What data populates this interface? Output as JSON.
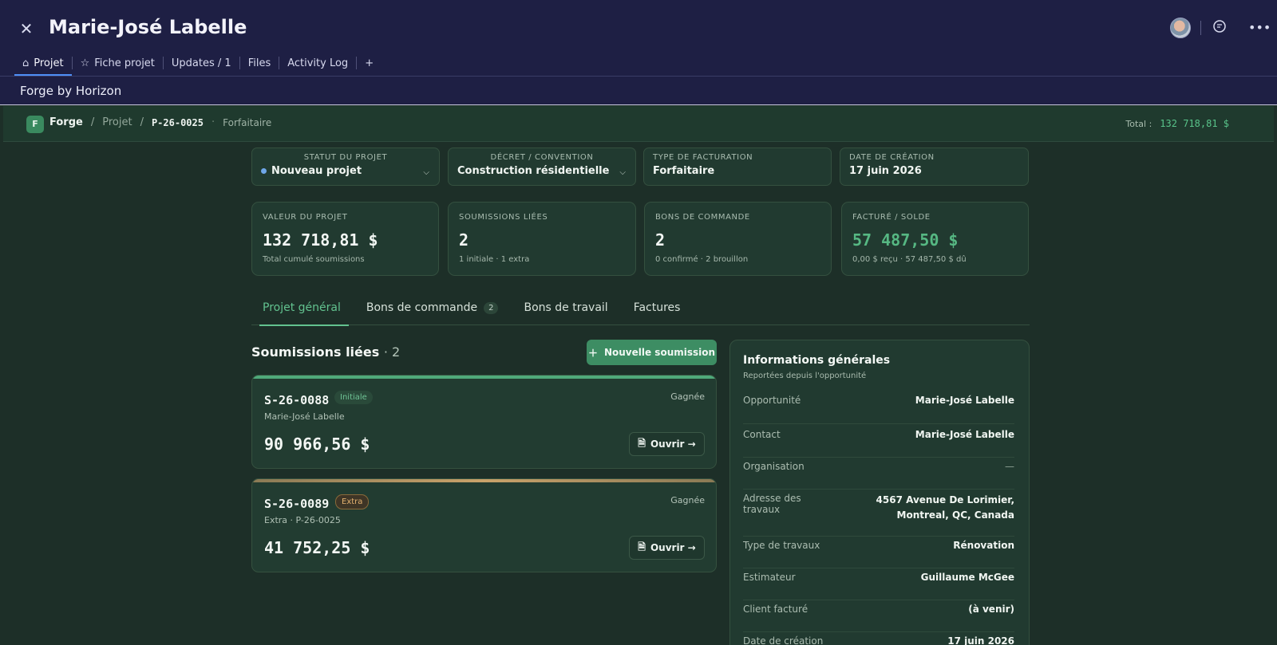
{
  "header": {
    "title": "Marie-José Labelle",
    "tabs": [
      {
        "label": "Projet",
        "icon": "home-icon"
      },
      {
        "label": "Fiche projet",
        "icon": "star-icon"
      },
      {
        "label": "Updates / 1"
      },
      {
        "label": "Files"
      },
      {
        "label": "Activity Log"
      },
      {
        "label": "+"
      }
    ]
  },
  "workspace": {
    "title": "Forge by Horizon"
  },
  "breadcrumb": {
    "logo_letter": "F",
    "app": "Forge",
    "section": "Projet",
    "project_code": "P-26-0025",
    "billing_type": "Forfaitaire",
    "total_label": "Total :",
    "total_value": "132 718,81 $"
  },
  "fields": {
    "status": {
      "label": "STATUT DU PROJET",
      "value": "Nouveau projet"
    },
    "decree": {
      "label": "DÉCRET / CONVENTION",
      "value": "Construction résidentielle"
    },
    "billing": {
      "label": "TYPE DE FACTURATION",
      "value": "Forfaitaire"
    },
    "created": {
      "label": "DATE DE CRÉATION",
      "value": "17 juin 2026"
    }
  },
  "stats": {
    "value": {
      "label": "VALEUR DU PROJET",
      "value": "132 718,81 $",
      "sub": "Total cumulé soumissions"
    },
    "submissions": {
      "label": "SOUMISSIONS LIÉES",
      "value": "2",
      "sub": "1 initiale · 1 extra"
    },
    "orders": {
      "label": "BONS DE COMMANDE",
      "value": "2",
      "sub": "0 confirmé · 2 brouillon"
    },
    "billed": {
      "label": "FACTURÉ / SOLDE",
      "value": "57 487,50 $",
      "sub": "0,00 $ reçu · 57 487,50 $ dû"
    }
  },
  "main_tabs": {
    "general": "Projet général",
    "orders": "Bons de commande",
    "orders_count": "2",
    "work": "Bons de travail",
    "invoices": "Factures"
  },
  "submissions": {
    "title": "Soumissions liées",
    "count": "· 2",
    "new_button": "Nouvelle soumission",
    "items": [
      {
        "code": "S-26-0088",
        "tag": "Initiale",
        "status": "Gagnée",
        "client": "Marie-José Labelle",
        "amount": "90 966,56 $",
        "open": "Ouvrir →"
      },
      {
        "code": "S-26-0089",
        "tag": "Extra",
        "status": "Gagnée",
        "client": "Extra · P-26-0025",
        "amount": "41 752,25 $",
        "open": "Ouvrir →"
      }
    ]
  },
  "info": {
    "title": "Informations générales",
    "subtitle": "Reportées depuis l'opportunité",
    "rows": [
      {
        "key": "Opportunité",
        "value": "Marie-José Labelle"
      },
      {
        "key": "Contact",
        "value": "Marie-José Labelle"
      },
      {
        "key": "Organisation",
        "value": "—"
      },
      {
        "key": "Adresse des travaux",
        "value": "4567 Avenue De Lorimier, Montreal, QC, Canada"
      },
      {
        "key": "Type de travaux",
        "value": "Rénovation"
      },
      {
        "key": "Estimateur",
        "value": "Guillaume McGee"
      },
      {
        "key": "Client facturé",
        "value": "(à venir)"
      },
      {
        "key": "Date de création",
        "value": "17 juin 2026"
      }
    ]
  },
  "colors": {
    "accent_green": "#3d8d63",
    "header_bg": "#1e1f44",
    "page_bg": "#1d2f28",
    "tab_underline": "#4f8ff7",
    "extra_gold": "#c9a26a"
  }
}
